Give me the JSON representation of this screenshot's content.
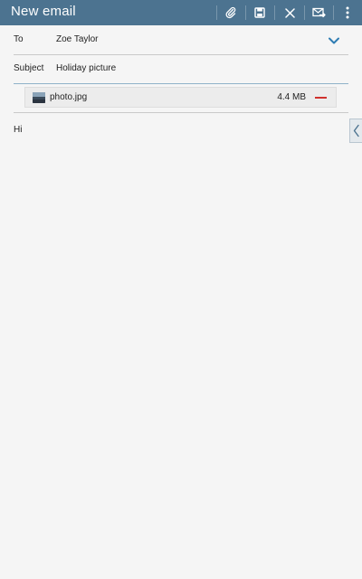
{
  "header": {
    "title": "New email",
    "actions": [
      {
        "icon": "attach-icon"
      },
      {
        "icon": "save-icon"
      },
      {
        "icon": "close-icon"
      },
      {
        "icon": "send-icon"
      },
      {
        "icon": "overflow-menu-icon"
      }
    ],
    "background": "#4c7390"
  },
  "to": {
    "label": "To",
    "value": "Zoe Taylor"
  },
  "subject": {
    "label": "Subject",
    "value": "Holiday picture"
  },
  "attachment": {
    "name": "photo.jpg",
    "size": "4.4 MB",
    "remove_color": "#d0312d"
  },
  "body": {
    "text": "Hi"
  }
}
